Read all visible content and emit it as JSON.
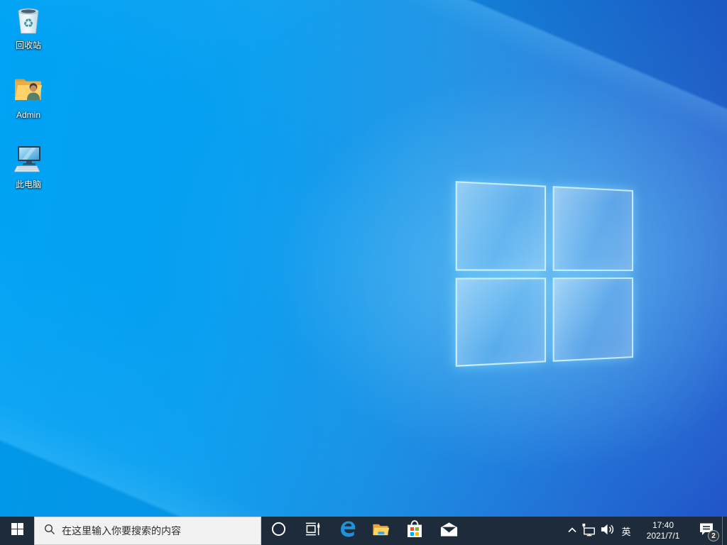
{
  "desktop": {
    "icons": [
      {
        "id": "recycle-bin",
        "label": "回收站"
      },
      {
        "id": "admin-folder",
        "label": "Admin"
      },
      {
        "id": "this-pc",
        "label": "此电脑"
      }
    ]
  },
  "taskbar": {
    "search_placeholder": "在这里输入你要搜索的内容",
    "buttons": [
      "start",
      "cortana",
      "task-view",
      "edge",
      "file-explorer",
      "store",
      "mail"
    ],
    "tray": {
      "language_indicator": "英",
      "time": "17:40",
      "date": "2021/7/1",
      "notification_badge": "2"
    }
  },
  "colors": {
    "taskbar_bg": "#1d2b3a",
    "search_bg": "#f2f2f2",
    "wallpaper_left": "#00a3f5",
    "wallpaper_right": "#1f51c6",
    "edge_blue": "#1e93dd",
    "store_red": "#f25022",
    "store_green": "#7fba00",
    "store_blue": "#00a4ef",
    "store_yellow": "#ffb900"
  }
}
